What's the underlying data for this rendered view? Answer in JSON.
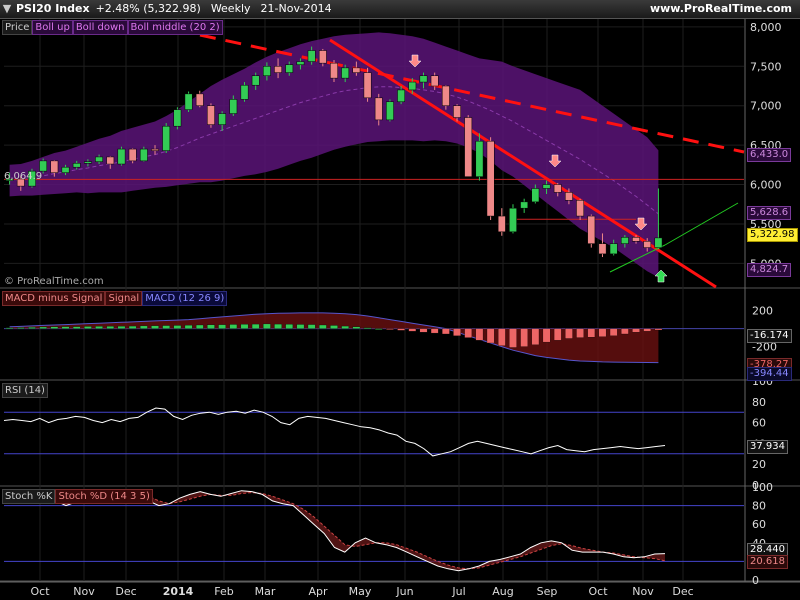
{
  "header": {
    "symbol": "PSI20 Index",
    "change": "+2.48% (5,322.98)",
    "frequency": "Weekly",
    "date": "21-Nov-2014",
    "site": "www.ProRealTime.com"
  },
  "copyright": "© ProRealTime.com",
  "legends": {
    "price": [
      "Price",
      "Boll up",
      "Boll down",
      "Boll middle (20 2)"
    ],
    "macd": [
      "MACD minus Signal",
      "Signal",
      "MACD (12 26 9)"
    ],
    "rsi": [
      "RSI (14)"
    ],
    "stoch": [
      "Stoch %K",
      "Stoch %D (14 3 5)"
    ]
  },
  "colors": {
    "up": "#33cc55",
    "down": "#ee8888",
    "band": "#5a1478",
    "trend": "#ff1111",
    "macd_hist_pos": "#33cc55",
    "macd_hist_neg": "#ee6666",
    "rsi_line": "#ffffff",
    "stoch_k": "#ffffff",
    "stoch_d": "#cc4444",
    "level_line": "#4444cc"
  },
  "tags": {
    "price_left": "6,064.9",
    "boll_up": "6,433.0",
    "boll_mid": "5,628.6",
    "last": "5,322.98",
    "boll_down": "4,824.7",
    "macd": "-16.174",
    "signal": "-378.27",
    "macd_line": "-394.44",
    "rsi": "37.934",
    "stoch_k": "28.440",
    "stoch_d": "20.618"
  },
  "chart_data": {
    "type": "candlestick",
    "x_labels": [
      "Oct",
      "Nov",
      "Dec",
      "2014",
      "Feb",
      "Mar",
      "Apr",
      "May",
      "Jun",
      "Jul",
      "Aug",
      "Sep",
      "Oct",
      "Nov",
      "Dec"
    ],
    "price_axis": {
      "ticks": [
        "8,000",
        "7,500",
        "7,000",
        "6,500",
        "6,000",
        "5,500",
        "5,000"
      ],
      "ylim": [
        4700,
        8100
      ]
    },
    "macd_axis": {
      "ticks": [
        "200",
        "-200"
      ],
      "ylim": [
        -560,
        440
      ]
    },
    "rsi_axis": {
      "ticks": [
        "100",
        "80",
        "60",
        "40",
        "20",
        "0"
      ],
      "ylim": [
        0,
        100
      ]
    },
    "stoch_axis": {
      "ticks": [
        "100",
        "80",
        "60",
        "40",
        "20",
        "0"
      ],
      "ylim": [
        0,
        100
      ]
    },
    "ohlc": [
      [
        6050,
        6150,
        6000,
        6070
      ],
      [
        6070,
        6110,
        5920,
        5980
      ],
      [
        5980,
        6200,
        5960,
        6170
      ],
      [
        6170,
        6330,
        6140,
        6300
      ],
      [
        6300,
        6310,
        6100,
        6150
      ],
      [
        6150,
        6250,
        6120,
        6220
      ],
      [
        6220,
        6300,
        6190,
        6270
      ],
      [
        6270,
        6320,
        6230,
        6290
      ],
      [
        6290,
        6380,
        6260,
        6350
      ],
      [
        6350,
        6360,
        6200,
        6260
      ],
      [
        6260,
        6480,
        6240,
        6450
      ],
      [
        6450,
        6460,
        6270,
        6300
      ],
      [
        6300,
        6480,
        6290,
        6450
      ],
      [
        6450,
        6500,
        6380,
        6430
      ],
      [
        6430,
        6780,
        6400,
        6740
      ],
      [
        6740,
        6980,
        6700,
        6950
      ],
      [
        6950,
        7180,
        6920,
        7150
      ],
      [
        7150,
        7190,
        6980,
        7000
      ],
      [
        7000,
        7030,
        6720,
        6760
      ],
      [
        6760,
        6930,
        6680,
        6900
      ],
      [
        6900,
        7130,
        6870,
        7080
      ],
      [
        7080,
        7300,
        7050,
        7260
      ],
      [
        7260,
        7420,
        7200,
        7380
      ],
      [
        7380,
        7550,
        7320,
        7500
      ],
      [
        7500,
        7600,
        7350,
        7420
      ],
      [
        7420,
        7560,
        7380,
        7520
      ],
      [
        7520,
        7600,
        7460,
        7560
      ],
      [
        7560,
        7750,
        7520,
        7700
      ],
      [
        7700,
        7720,
        7500,
        7540
      ],
      [
        7540,
        7580,
        7300,
        7350
      ],
      [
        7350,
        7520,
        7300,
        7480
      ],
      [
        7480,
        7560,
        7380,
        7420
      ],
      [
        7420,
        7480,
        7050,
        7100
      ],
      [
        7100,
        7150,
        6750,
        6820
      ],
      [
        6820,
        7080,
        6800,
        7050
      ],
      [
        7050,
        7250,
        7020,
        7200
      ],
      [
        7200,
        7350,
        7150,
        7300
      ],
      [
        7300,
        7420,
        7220,
        7380
      ],
      [
        7380,
        7420,
        7200,
        7250
      ],
      [
        7250,
        7260,
        6950,
        7000
      ],
      [
        7000,
        7020,
        6800,
        6850
      ],
      [
        6850,
        6880,
        6200,
        6100
      ],
      [
        6100,
        6650,
        6050,
        6550
      ],
      [
        6550,
        6600,
        5550,
        5600
      ],
      [
        5600,
        5700,
        5350,
        5400
      ],
      [
        5400,
        5750,
        5380,
        5700
      ],
      [
        5700,
        5820,
        5640,
        5780
      ],
      [
        5780,
        6000,
        5760,
        5950
      ],
      [
        5950,
        6050,
        5880,
        6000
      ],
      [
        6000,
        6020,
        5850,
        5900
      ],
      [
        5900,
        5950,
        5750,
        5800
      ],
      [
        5800,
        5820,
        5550,
        5600
      ],
      [
        5600,
        5620,
        5200,
        5250
      ],
      [
        5250,
        5380,
        5080,
        5120
      ],
      [
        5120,
        5300,
        5100,
        5250
      ],
      [
        5250,
        5360,
        5200,
        5330
      ],
      [
        5330,
        5360,
        5250,
        5280
      ],
      [
        5280,
        5320,
        5150,
        5200
      ],
      [
        5200,
        5950,
        5180,
        5323
      ]
    ],
    "boll_up": [
      6250,
      6260,
      6300,
      6350,
      6400,
      6430,
      6480,
      6530,
      6580,
      6620,
      6680,
      6720,
      6760,
      6800,
      6870,
      6950,
      7050,
      7150,
      7250,
      7330,
      7400,
      7470,
      7550,
      7620,
      7680,
      7730,
      7780,
      7820,
      7850,
      7880,
      7900,
      7910,
      7920,
      7930,
      7920,
      7900,
      7880,
      7850,
      7800,
      7750,
      7700,
      7650,
      7600,
      7580,
      7560,
      7500,
      7450,
      7400,
      7350,
      7300,
      7250,
      7200,
      7100,
      7000,
      6900,
      6800,
      6700,
      6600,
      6433
    ],
    "boll_mid": [
      6050,
      6060,
      6080,
      6110,
      6140,
      6160,
      6190,
      6210,
      6240,
      6260,
      6290,
      6320,
      6350,
      6380,
      6420,
      6470,
      6530,
      6590,
      6640,
      6690,
      6740,
      6790,
      6840,
      6890,
      6940,
      6990,
      7040,
      7080,
      7120,
      7160,
      7190,
      7210,
      7230,
      7240,
      7240,
      7230,
      7220,
      7200,
      7180,
      7150,
      7110,
      7060,
      7000,
      6940,
      6870,
      6800,
      6720,
      6640,
      6560,
      6480,
      6400,
      6320,
      6230,
      6140,
      6050,
      5950,
      5850,
      5740,
      5628
    ],
    "boll_down": [
      5850,
      5860,
      5860,
      5870,
      5880,
      5890,
      5900,
      5890,
      5900,
      5900,
      5900,
      5920,
      5940,
      5960,
      5970,
      5990,
      6010,
      6030,
      6030,
      6050,
      6080,
      6110,
      6130,
      6160,
      6200,
      6250,
      6300,
      6340,
      6390,
      6440,
      6480,
      6510,
      6540,
      6550,
      6560,
      6560,
      6560,
      6550,
      6560,
      6550,
      6520,
      6470,
      6400,
      6300,
      6180,
      6100,
      5990,
      5880,
      5770,
      5660,
      5550,
      5440,
      5360,
      5280,
      5200,
      5100,
      5000,
      4900,
      4824
    ],
    "macd_hist": [
      10,
      12,
      15,
      18,
      20,
      22,
      22,
      24,
      25,
      26,
      27,
      28,
      30,
      32,
      34,
      35,
      38,
      40,
      42,
      44,
      46,
      48,
      50,
      52,
      50,
      48,
      46,
      45,
      40,
      35,
      28,
      20,
      10,
      0,
      -10,
      -20,
      -30,
      -40,
      -50,
      -60,
      -80,
      -100,
      -130,
      -160,
      -190,
      -210,
      -200,
      -180,
      -150,
      -130,
      -110,
      -100,
      -95,
      -90,
      -80,
      -60,
      -40,
      -30,
      -16
    ],
    "signal": [
      20,
      25,
      30,
      35,
      40,
      45,
      50,
      55,
      60,
      65,
      70,
      75,
      80,
      85,
      90,
      95,
      100,
      110,
      120,
      130,
      140,
      150,
      160,
      165,
      170,
      172,
      174,
      175,
      175,
      170,
      165,
      155,
      140,
      120,
      100,
      80,
      60,
      40,
      20,
      0,
      -40,
      -80,
      -120,
      -160,
      -200,
      -240,
      -270,
      -300,
      -320,
      -335,
      -350,
      -360,
      -365,
      -370,
      -372,
      -374,
      -376,
      -377,
      -378
    ],
    "rsi": [
      62,
      63,
      62,
      61,
      64,
      60,
      63,
      64,
      66,
      65,
      62,
      60,
      63,
      61,
      64,
      65,
      70,
      74,
      73,
      66,
      63,
      67,
      69,
      70,
      68,
      70,
      71,
      69,
      72,
      70,
      66,
      60,
      58,
      64,
      66,
      65,
      64,
      62,
      60,
      58,
      56,
      55,
      53,
      50,
      48,
      42,
      40,
      35,
      28,
      30,
      32,
      36,
      40,
      42,
      40,
      38,
      36,
      34,
      32,
      30,
      33,
      36,
      38,
      34,
      33,
      32,
      34,
      35,
      36,
      37,
      36,
      35,
      36,
      37,
      38
    ],
    "stoch_k": [
      90,
      92,
      95,
      92,
      88,
      85,
      80,
      84,
      88,
      92,
      95,
      97,
      95,
      93,
      85,
      80,
      82,
      88,
      92,
      95,
      92,
      90,
      93,
      96,
      95,
      92,
      85,
      82,
      80,
      70,
      60,
      50,
      35,
      30,
      40,
      45,
      40,
      38,
      35,
      30,
      25,
      20,
      15,
      12,
      10,
      12,
      15,
      20,
      22,
      25,
      28,
      35,
      40,
      42,
      40,
      32,
      30,
      30,
      30,
      28,
      25,
      24,
      25,
      28,
      28.44
    ],
    "stoch_d": [
      85,
      88,
      90,
      92,
      90,
      86,
      83,
      83,
      85,
      88,
      90,
      92,
      93,
      93,
      90,
      85,
      82,
      84,
      87,
      90,
      92,
      91,
      91,
      93,
      94,
      93,
      90,
      86,
      82,
      76,
      68,
      58,
      48,
      38,
      36,
      38,
      40,
      40,
      38,
      34,
      30,
      25,
      20,
      16,
      13,
      12,
      13,
      16,
      19,
      22,
      25,
      29,
      33,
      37,
      39,
      37,
      34,
      32,
      30,
      29,
      27,
      25,
      24,
      23,
      20.618
    ]
  }
}
